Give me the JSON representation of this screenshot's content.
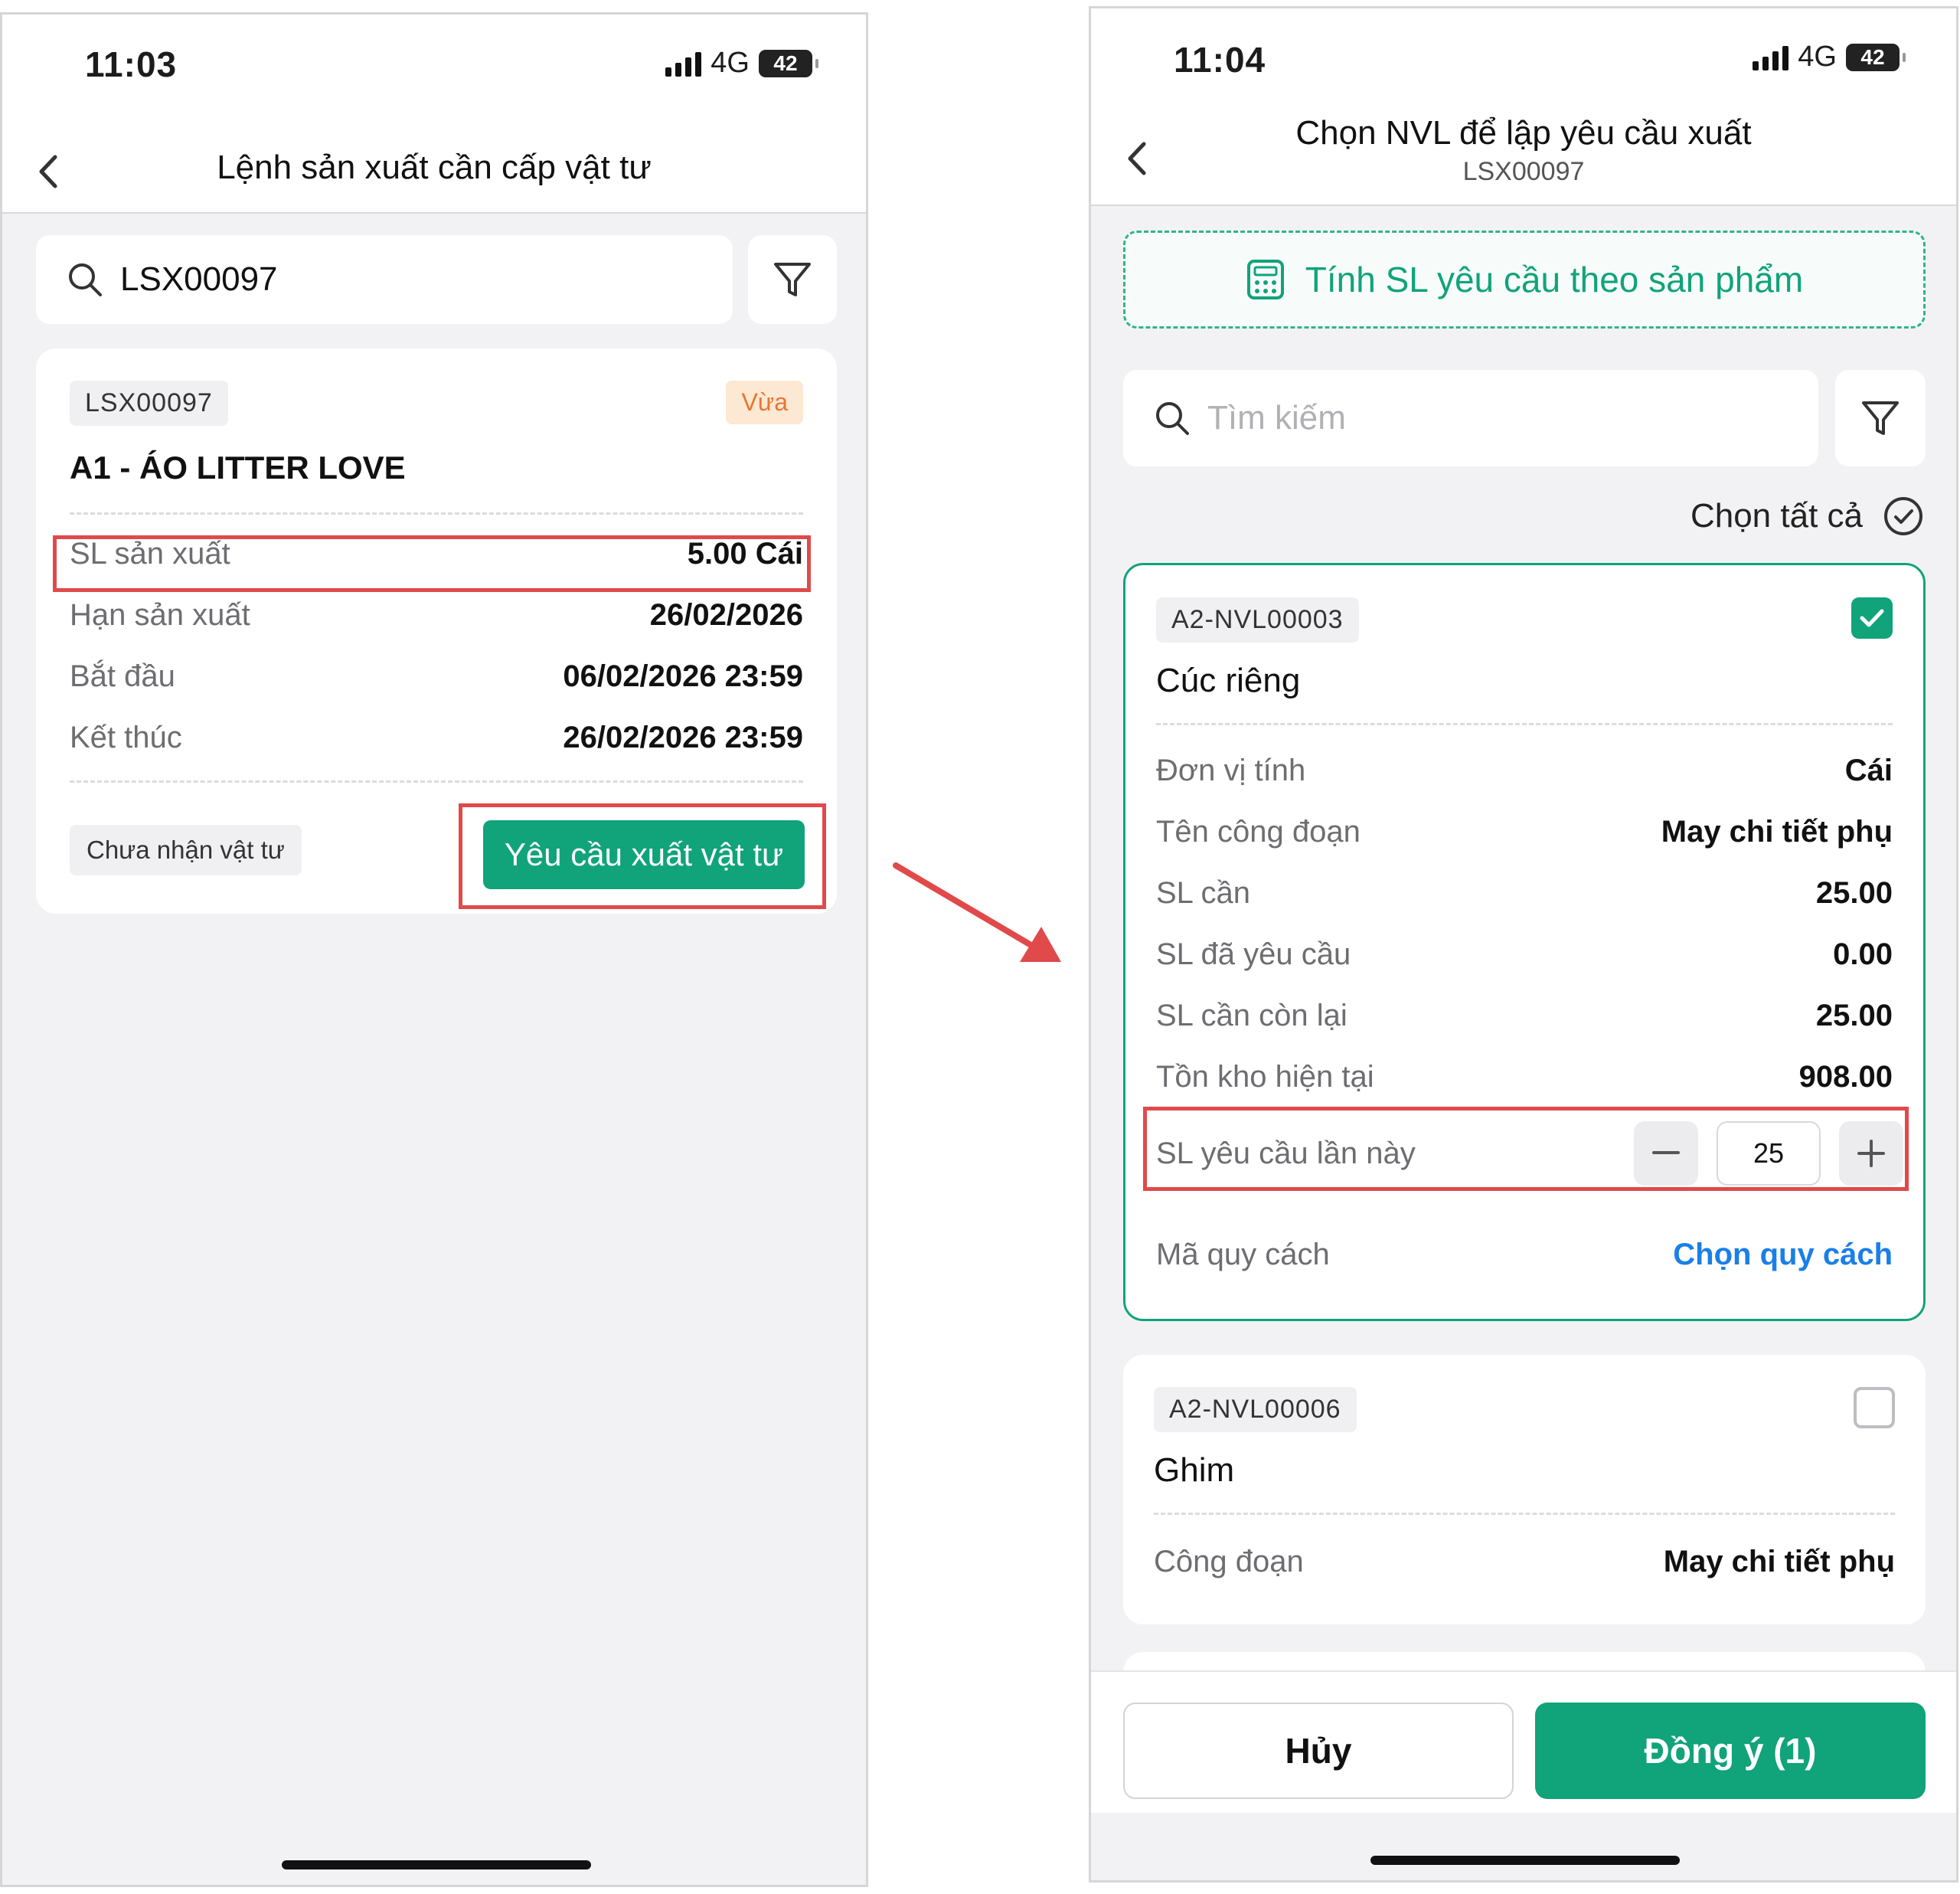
{
  "left_screen": {
    "status": {
      "time": "11:03",
      "network": "4G",
      "battery": "42"
    },
    "title": "Lệnh sản xuất cần cấp vật tư",
    "search": {
      "value": "LSX00097"
    },
    "order_card": {
      "code": "LSX00097",
      "priority": "Vừa",
      "product": "A1 - ÁO LITTER LOVE",
      "rows": [
        {
          "label": "SL sản xuất",
          "value": "5.00 Cái"
        },
        {
          "label": "Hạn sản xuất",
          "value": "26/02/2026"
        },
        {
          "label": "Bắt đầu",
          "value": "06/02/2026 23:59"
        },
        {
          "label": "Kết thúc",
          "value": "26/02/2026 23:59"
        }
      ],
      "status": "Chưa nhận vật tư",
      "action_label": "Yêu cầu xuất vật tư"
    }
  },
  "right_screen": {
    "status": {
      "time": "11:04",
      "network": "4G",
      "battery": "42"
    },
    "title": "Chọn NVL để lập yêu cầu xuất",
    "subtitle": "LSX00097",
    "calc_button": "Tính SL yêu cầu theo sản phẩm",
    "search": {
      "placeholder": "Tìm kiếm"
    },
    "select_all": "Chọn tất cả",
    "materials": [
      {
        "code": "A2-NVL00003",
        "name": "Cúc riêng",
        "checked": true,
        "rows": [
          {
            "label": "Đơn vị tính",
            "value": "Cái"
          },
          {
            "label": "Tên công đoạn",
            "value": "May chi tiết phụ"
          },
          {
            "label": "SL cần",
            "value": "25.00"
          },
          {
            "label": "SL đã yêu cầu",
            "value": "0.00"
          },
          {
            "label": "SL cần còn lại",
            "value": "25.00"
          },
          {
            "label": "Tồn kho hiện tại",
            "value": "908.00"
          }
        ],
        "request_label": "SL yêu cầu lần này",
        "request_qty": "25",
        "spec_label": "Mã quy cách",
        "spec_action": "Chọn quy cách"
      },
      {
        "code": "A2-NVL00006",
        "name": "Ghim",
        "checked": false,
        "rows": [
          {
            "label": "Công đoạn",
            "value": "May chi tiết phụ"
          }
        ]
      }
    ],
    "cancel_label": "Hủy",
    "confirm_label": "Đồng ý (1)"
  },
  "colors": {
    "accent": "#11a37a",
    "highlight": "#e04a4a",
    "link": "#1a7fe6",
    "priority_bg": "#fde8d4",
    "priority_text": "#e8772e"
  }
}
